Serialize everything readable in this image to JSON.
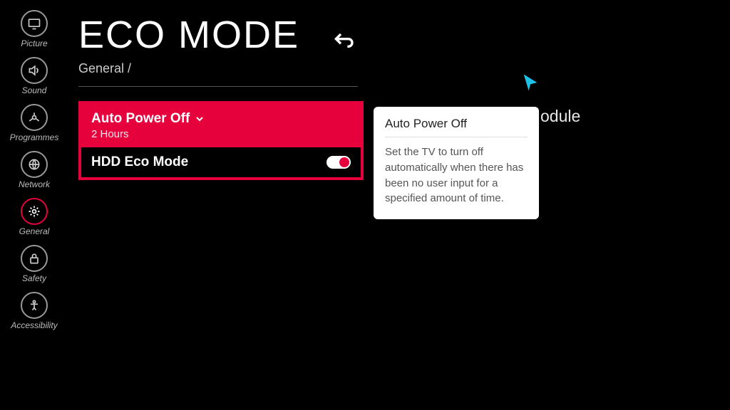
{
  "sidebar": {
    "items": [
      {
        "label": "Picture"
      },
      {
        "label": "Sound"
      },
      {
        "label": "Programmes"
      },
      {
        "label": "Network"
      },
      {
        "label": "General"
      },
      {
        "label": "Safety"
      },
      {
        "label": "Accessibility"
      }
    ]
  },
  "header": {
    "title": "ECO MODE",
    "breadcrumb": "General /"
  },
  "settings": {
    "auto_power_off": {
      "label": "Auto Power Off",
      "value": "2 Hours"
    },
    "hdd_eco_mode": {
      "label": "HDD Eco Mode",
      "on": true
    }
  },
  "tooltip": {
    "title": "Auto Power Off",
    "body": "Set the TV to turn off automatically when there has been no user input for a specified amount of time."
  },
  "background_text": "odule"
}
